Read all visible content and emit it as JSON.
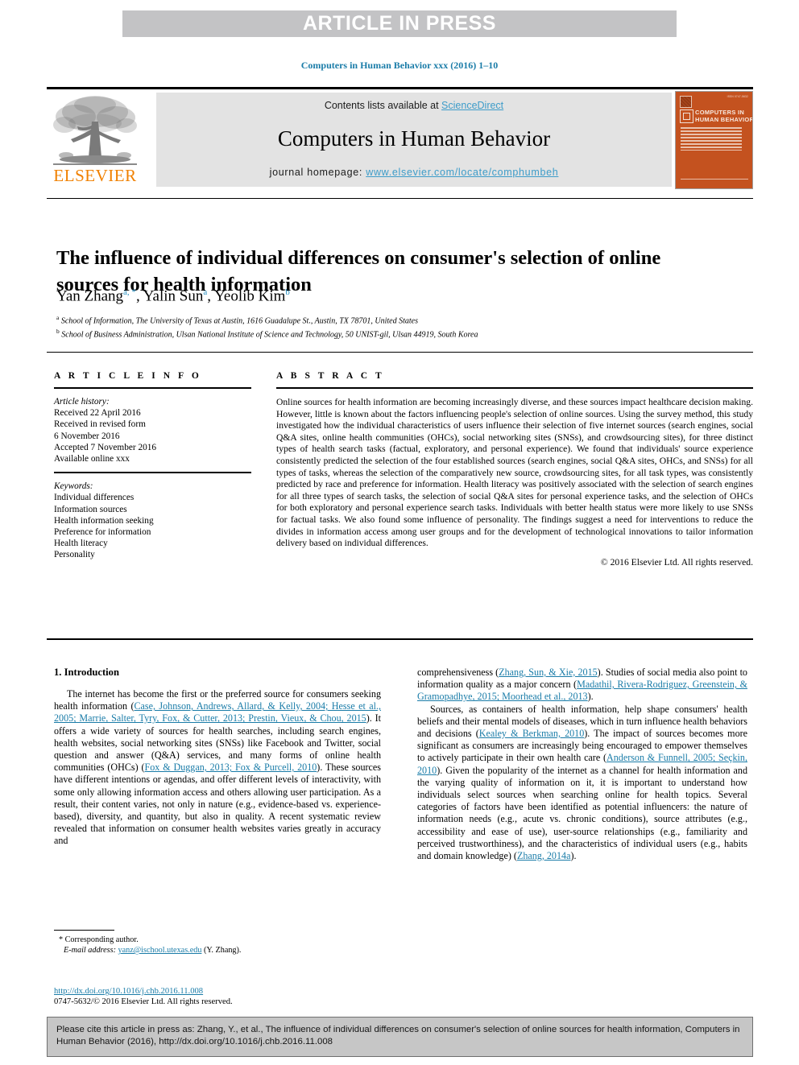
{
  "banner": {
    "label": "ARTICLE IN PRESS"
  },
  "running_head": "Computers in Human Behavior xxx (2016) 1–10",
  "masthead": {
    "publisher_wordmark": "ELSEVIER",
    "contents_prefix": "Contents lists available at ",
    "contents_link": "ScienceDirect",
    "journal_title": "Computers in Human Behavior",
    "homepage_prefix": "journal homepage: ",
    "homepage_link": "www.elsevier.com/locate/comphumbeh",
    "cover": {
      "title_line1": "COMPUTERS IN",
      "title_line2": "HUMAN BEHAVIOR",
      "corner_label": "ISSN 0747-5632"
    }
  },
  "article": {
    "title": "The influence of individual differences on consumer's selection of online sources for health information",
    "authors": [
      {
        "name": "Yan Zhang",
        "marks": "a, *"
      },
      {
        "name": "Yalin Sun",
        "marks": "a"
      },
      {
        "name": "Yeolib Kim",
        "marks": "b"
      }
    ],
    "affiliations": [
      {
        "mark": "a",
        "text": "School of Information, The University of Texas at Austin, 1616 Guadalupe St., Austin, TX 78701, United States"
      },
      {
        "mark": "b",
        "text": "School of Business Administration, Ulsan National Institute of Science and Technology, 50 UNIST-gil, Ulsan 44919, South Korea"
      }
    ]
  },
  "article_info": {
    "heading": "A R T I C L E   I N F O",
    "history_label": "Article history:",
    "history": [
      "Received 22 April 2016",
      "Received in revised form",
      "6 November 2016",
      "Accepted 7 November 2016",
      "Available online xxx"
    ],
    "keywords_label": "Keywords:",
    "keywords": [
      "Individual differences",
      "Information sources",
      "Health information seeking",
      "Preference for information",
      "Health literacy",
      "Personality"
    ]
  },
  "abstract": {
    "heading": "A B S T R A C T",
    "body": "Online sources for health information are becoming increasingly diverse, and these sources impact healthcare decision making. However, little is known about the factors influencing people's selection of online sources. Using the survey method, this study investigated how the individual characteristics of users influence their selection of five internet sources (search engines, social Q&A sites, online health communities (OHCs), social networking sites (SNSs), and crowdsourcing sites), for three distinct types of health search tasks (factual, exploratory, and personal experience). We found that individuals' source experience consistently predicted the selection of the four established sources (search engines, social Q&A sites, OHCs, and SNSs) for all types of tasks, whereas the selection of the comparatively new source, crowdsourcing sites, for all task types, was consistently predicted by race and preference for information. Health literacy was positively associated with the selection of search engines for all three types of search tasks, the selection of social Q&A sites for personal experience tasks, and the selection of OHCs for both exploratory and personal experience search tasks. Individuals with better health status were more likely to use SNSs for factual tasks. We also found some influence of personality. The findings suggest a need for interventions to reduce the divides in information access among user groups and for the development of technological innovations to tailor information delivery based on individual differences.",
    "copyright": "© 2016 Elsevier Ltd. All rights reserved."
  },
  "body": {
    "section_number_title": "1.  Introduction",
    "left_paragraph_1_part1": "The internet has become the first or the preferred source for consumers seeking health information (",
    "left_paragraph_1_ref1": "Case, Johnson, Andrews, Allard, & Kelly, 2004; Hesse et al., 2005; Marrie, Salter, Tyry, Fox, & Cutter, 2013; Prestin, Vieux, & Chou, 2015",
    "left_paragraph_1_part2": "). It offers a wide variety of sources for health searches, including search engines, health websites, social networking sites (SNSs) like Facebook and Twitter, social question and answer (Q&A) services, and many forms of online health communities (OHCs) (",
    "left_paragraph_1_ref2": "Fox & Duggan, 2013; Fox & Purcell, 2010",
    "left_paragraph_1_part3": "). These sources have different intentions or agendas, and offer different levels of interactivity, with some only allowing information access and others allowing user participation. As a result, their content varies, not only in nature (e.g., evidence-based vs. experience-based), diversity, and quantity, but also in quality. A recent systematic review revealed that information on consumer health websites varies greatly in accuracy and",
    "right_paragraph_1_part1": "comprehensiveness (",
    "right_paragraph_1_ref1": "Zhang, Sun, & Xie, 2015",
    "right_paragraph_1_part2": "). Studies of social media also point to information quality as a major concern (",
    "right_paragraph_1_ref2": "Madathil, Rivera-Rodriguez, Greenstein, & Gramopadhye, 2015; Moorhead et al., 2013",
    "right_paragraph_1_part3": ").",
    "right_paragraph_2_part1": "Sources, as containers of health information, help shape consumers' health beliefs and their mental models of diseases, which in turn influence health behaviors and decisions (",
    "right_paragraph_2_ref1": "Kealey & Berkman, 2010",
    "right_paragraph_2_part2": "). The impact of sources becomes more significant as consumers are increasingly being encouraged to empower themselves to actively participate in their own health care (",
    "right_paragraph_2_ref2": "Anderson & Funnell, 2005; Seçkin, 2010",
    "right_paragraph_2_part3": "). Given the popularity of the internet as a channel for health information and the varying quality of information on it, it is important to understand how individuals select sources when searching online for health topics. Several categories of factors have been identified as potential influencers: the nature of information needs (e.g., acute vs. chronic conditions), source attributes (e.g., accessibility and ease of use), user-source relationships (e.g., familiarity and perceived trustworthiness), and the characteristics of individual users (e.g., habits and domain knowledge) (",
    "right_paragraph_2_ref3": "Zhang, 2014a",
    "right_paragraph_2_part4": ")."
  },
  "footnote": {
    "corresponding_marker": "*",
    "corresponding_text": "Corresponding author.",
    "email_label": "E-mail address:",
    "email": "yanz@ischool.utexas.edu",
    "email_suffix": "(Y. Zhang)."
  },
  "doi_block": {
    "doi_url": "http://dx.doi.org/10.1016/j.chb.2016.11.008",
    "issn_copyright": "0747-5632/© 2016 Elsevier Ltd. All rights reserved."
  },
  "citation_footer": {
    "text": "Please cite this article in press as: Zhang, Y., et al., The influence of individual differences on consumer's selection of online sources for health information, Computers in Human Behavior (2016), http://dx.doi.org/10.1016/j.chb.2016.11.008"
  },
  "colors": {
    "link_blue": "#1a7ca8",
    "sciencedirect_blue": "#3d9cc9",
    "elsevier_orange": "#f08000",
    "banner_gray": "#c3c3c5",
    "masthead_gray": "#e3e3e3",
    "footer_gray": "#c6c6c6",
    "cover_orange": "#c4521f"
  }
}
